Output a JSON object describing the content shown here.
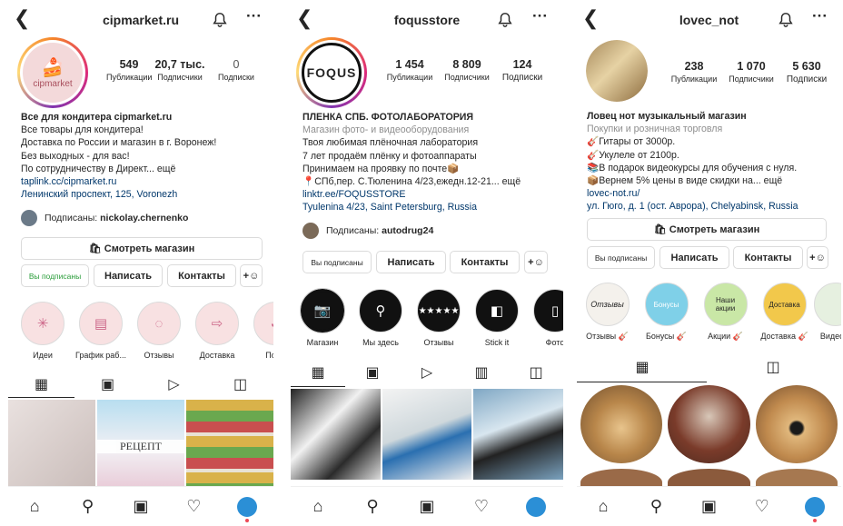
{
  "panels": [
    {
      "username": "cipmarket.ru",
      "avatar_text": "cipmarket",
      "stats": [
        {
          "num": "549",
          "label": "Публикации"
        },
        {
          "num": "20,7 тыс.",
          "label": "Подписчики"
        },
        {
          "num": "0",
          "label": "Подписки"
        }
      ],
      "bio": [
        "Все для кондитера cipmarket.ru",
        "Все товары для кондитера!",
        "Доставка по России и магазин в г. Воронеж!",
        "Без выходных - для вас!",
        "По сотрудничеству в Директ... ещё",
        "taplink.cc/cipmarket.ru",
        "Ленинский проспект, 125, Voronezh"
      ],
      "followed_by_prefix": "Подписаны:",
      "followed_by": "nickolay.chernenko",
      "shop_button": "Смотреть магазин",
      "buttons": [
        "Вы подписаны",
        "Написать",
        "Контакты"
      ],
      "highlights": [
        "Идеи",
        "График раб...",
        "Отзывы",
        "Доставка",
        "Подп"
      ],
      "grid_text": "РЕЦЕПТ"
    },
    {
      "username": "foqusstore",
      "avatar_text": "FOQUS",
      "stats": [
        {
          "num": "1 454",
          "label": "Публикации"
        },
        {
          "num": "8 809",
          "label": "Подписчики"
        },
        {
          "num": "124",
          "label": "Подписки"
        }
      ],
      "bio": [
        "ПЛЕНКА СПБ. ФОТОЛАБОРАТОРИЯ",
        "Магазин фото- и видеооборудования",
        "Твоя любимая плёночная лаборатория",
        "7 лет продаём плёнку и фотоаппараты",
        "Принимаем на проявку по почте📦",
        "📍СПб,пер. С.Тюленина 4/23,ежедн.12-21... ещё",
        "linktr.ee/FOQUSSTORE",
        "Tyulenina 4/23, Saint Petersburg, Russia"
      ],
      "followed_by_prefix": "Подписаны:",
      "followed_by": "autodrug24",
      "buttons": [
        "Вы подписаны",
        "Написать",
        "Контакты"
      ],
      "highlights": [
        "Магазин",
        "Мы здесь",
        "Отзывы",
        "Stick it",
        "Фото"
      ]
    },
    {
      "username": "lovec_not",
      "stats": [
        {
          "num": "238",
          "label": "Публикации"
        },
        {
          "num": "1 070",
          "label": "Подписчики"
        },
        {
          "num": "5 630",
          "label": "Подписки"
        }
      ],
      "bio": [
        "Ловец нот музыкальный магазин",
        "Покупки и розничная торговля",
        "🎸Гитары от 3000р.",
        "🎸Укулеле от 2100р.",
        "📚В подарок видеокурсы для обучения с нуля.",
        "📦Вернем 5% цены в виде скидки на... ещё",
        "lovec-not.ru/",
        "ул. Гюго, д. 1 (ост. Аврора), Chelyabinsk, Russia"
      ],
      "shop_button": "Смотреть магазин",
      "buttons": [
        "Вы подписаны",
        "Написать",
        "Контакты"
      ],
      "highlights": [
        "Отзывы 🎸",
        "Бонусы 🎸",
        "Акции 🎸",
        "Доставка 🎸",
        "Видео"
      ],
      "highlight_inner": [
        "Отзывы",
        "Бонусы",
        "Наши акции",
        "Доставка",
        ""
      ]
    }
  ],
  "icons": {
    "back": "‹",
    "more": "···",
    "add_person": "+👤"
  }
}
